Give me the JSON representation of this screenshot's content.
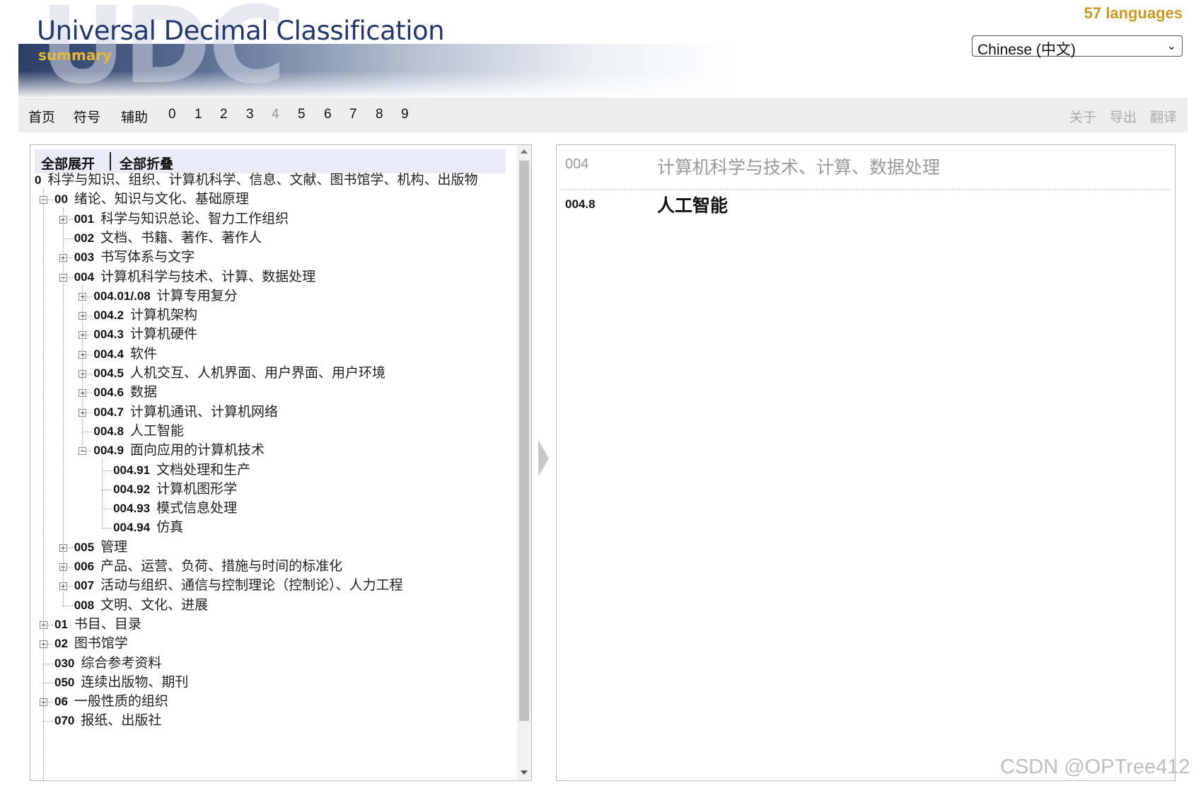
{
  "header": {
    "watermark": "UDC",
    "title": "Universal Decimal Classification",
    "subtitle": "summary"
  },
  "languages": {
    "count_label": "57 languages",
    "selected": "Chinese (中文)"
  },
  "nav": {
    "items": [
      "首页",
      "符号",
      "辅助",
      "0",
      "1",
      "2",
      "3",
      "4",
      "5",
      "6",
      "7",
      "8",
      "9"
    ],
    "right_items": [
      "关于",
      "导出",
      "翻译"
    ]
  },
  "tree_toolbar": {
    "expand_all": "全部展开",
    "collapse_all": "全部折叠"
  },
  "tree": [
    {
      "code": "0",
      "label": "科学与知识、组织、计算机科学、信息、文献、图书馆学、机构、出版物",
      "depth": 0,
      "toggle": "none"
    },
    {
      "code": "00",
      "label": "绪论、知识与文化、基础原理",
      "depth": 1,
      "toggle": "minus"
    },
    {
      "code": "001",
      "label": "科学与知识总论、智力工作组织",
      "depth": 2,
      "toggle": "plus"
    },
    {
      "code": "002",
      "label": "文档、书籍、著作、著作人",
      "depth": 2,
      "toggle": "none"
    },
    {
      "code": "003",
      "label": "书写体系与文字",
      "depth": 2,
      "toggle": "plus"
    },
    {
      "code": "004",
      "label": "计算机科学与技术、计算、数据处理",
      "depth": 2,
      "toggle": "minus"
    },
    {
      "code": "004.01/.08",
      "label": "计算专用复分",
      "depth": 3,
      "toggle": "plus"
    },
    {
      "code": "004.2",
      "label": "计算机架构",
      "depth": 3,
      "toggle": "plus"
    },
    {
      "code": "004.3",
      "label": "计算机硬件",
      "depth": 3,
      "toggle": "plus"
    },
    {
      "code": "004.4",
      "label": "软件",
      "depth": 3,
      "toggle": "plus"
    },
    {
      "code": "004.5",
      "label": "人机交互、人机界面、用户界面、用户环境",
      "depth": 3,
      "toggle": "plus"
    },
    {
      "code": "004.6",
      "label": "数据",
      "depth": 3,
      "toggle": "plus"
    },
    {
      "code": "004.7",
      "label": "计算机通讯、计算机网络",
      "depth": 3,
      "toggle": "plus"
    },
    {
      "code": "004.8",
      "label": "人工智能",
      "depth": 3,
      "toggle": "none"
    },
    {
      "code": "004.9",
      "label": "面向应用的计算机技术",
      "depth": 3,
      "toggle": "minus"
    },
    {
      "code": "004.91",
      "label": "文档处理和生产",
      "depth": 4,
      "toggle": "none"
    },
    {
      "code": "004.92",
      "label": "计算机图形学",
      "depth": 4,
      "toggle": "none"
    },
    {
      "code": "004.93",
      "label": "模式信息处理",
      "depth": 4,
      "toggle": "none"
    },
    {
      "code": "004.94",
      "label": "仿真",
      "depth": 4,
      "toggle": "none"
    },
    {
      "code": "005",
      "label": "管理",
      "depth": 2,
      "toggle": "plus"
    },
    {
      "code": "006",
      "label": "产品、运营、负荷、措施与时间的标准化",
      "depth": 2,
      "toggle": "plus"
    },
    {
      "code": "007",
      "label": "活动与组织、通信与控制理论（控制论）、人力工程",
      "depth": 2,
      "toggle": "plus"
    },
    {
      "code": "008",
      "label": "文明、文化、进展",
      "depth": 2,
      "toggle": "none"
    },
    {
      "code": "01",
      "label": "书目、目录",
      "depth": 1,
      "toggle": "plus"
    },
    {
      "code": "02",
      "label": "图书馆学",
      "depth": 1,
      "toggle": "plus"
    },
    {
      "code": "030",
      "label": "综合参考资料",
      "depth": 1,
      "toggle": "none"
    },
    {
      "code": "050",
      "label": "连续出版物、期刊",
      "depth": 1,
      "toggle": "none"
    },
    {
      "code": "06",
      "label": "一般性质的组织",
      "depth": 1,
      "toggle": "plus"
    },
    {
      "code": "070",
      "label": "报纸、出版社",
      "depth": 1,
      "toggle": "none"
    }
  ],
  "detail": {
    "parent_code": "004",
    "parent_title": "计算机科学与技术、计算、数据处理",
    "code": "004.8",
    "title": "人工智能"
  },
  "watermark_text": "CSDN @OPTree412",
  "colors": {
    "title": "#22386a",
    "subtitle": "#e5b838",
    "lang_count": "#c99a1e",
    "nav_bg": "#ededed",
    "toolbar_bg": "#ebebf7"
  }
}
